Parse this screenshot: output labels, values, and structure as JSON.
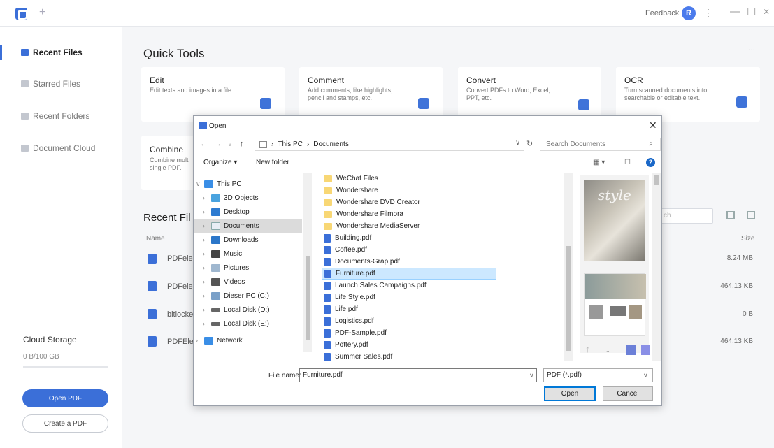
{
  "app": {
    "new_tab_label": "+",
    "feedback_label": "Feedback",
    "avatar_letter": "R",
    "kebab": "⋮",
    "minimize": "—",
    "maximize": "☐",
    "close": "✕"
  },
  "sidebar": {
    "items": [
      {
        "label": "Recent Files"
      },
      {
        "label": "Starred Files"
      },
      {
        "label": "Recent Folders"
      },
      {
        "label": "Document Cloud"
      }
    ],
    "cloud_title": "Cloud Storage",
    "cloud_size": "0 B/100 GB",
    "open_pdf": "Open PDF",
    "create_pdf": "Create a PDF"
  },
  "main": {
    "quick_tools_title": "Quick Tools",
    "more": "···",
    "cards": [
      {
        "title": "Edit",
        "desc": "Edit texts and images in a file."
      },
      {
        "title": "Comment",
        "desc": "Add comments, like highlights,\npencil and stamps, etc."
      },
      {
        "title": "Convert",
        "desc": "Convert PDFs to Word, Excel,\nPPT, etc."
      },
      {
        "title": "OCR",
        "desc": "Turn scanned documents into\nsearchable or editable text."
      },
      {
        "title": "Combine",
        "desc": "Combine mult\nsingle PDF."
      }
    ],
    "recent_title": "Recent Fil",
    "col_name": "Name",
    "col_size": "Size",
    "search_placeholder": "ch",
    "rows": [
      {
        "name": "PDFeler",
        "size": "8.24 MB"
      },
      {
        "name": "PDFeler",
        "size": "464.13 KB"
      },
      {
        "name": "bitlocke",
        "size": "0 B"
      },
      {
        "name": "PDFEler",
        "size": "464.13 KB"
      }
    ]
  },
  "dialog": {
    "title": "Open",
    "address": {
      "pc": "This PC",
      "folder": "Documents",
      "sep": "›"
    },
    "search_placeholder": "Search Documents",
    "organize": "Organize ▾",
    "new_folder": "New folder",
    "tree": [
      {
        "label": "This PC",
        "chev": "∨",
        "icon_color": "#3a8ee6"
      },
      {
        "label": "3D Objects",
        "chev": "›",
        "icon_color": "#4aa3df"
      },
      {
        "label": "Desktop",
        "chev": "›",
        "icon_color": "#2d7bd1"
      },
      {
        "label": "Documents",
        "chev": "›",
        "icon_color": "#e8eef5"
      },
      {
        "label": "Downloads",
        "chev": "›",
        "icon_color": "#2b76c9"
      },
      {
        "label": "Music",
        "chev": "›",
        "icon_color": "#444444"
      },
      {
        "label": "Pictures",
        "chev": "›",
        "icon_color": "#9fb7cf"
      },
      {
        "label": "Videos",
        "chev": "›",
        "icon_color": "#555555"
      },
      {
        "label": "Dieser PC (C:)",
        "chev": "›",
        "icon_color": "#7aa0c8"
      },
      {
        "label": "Local Disk (D:)",
        "chev": "›",
        "icon_color": "#666666"
      },
      {
        "label": "Local Disk (E:)",
        "chev": "›",
        "icon_color": "#666666"
      },
      {
        "label": "Network",
        "chev": "›",
        "icon_color": "#3a8ee6"
      }
    ],
    "files": [
      {
        "name": "WeChat Files",
        "type": "folder"
      },
      {
        "name": "Wondershare",
        "type": "folder"
      },
      {
        "name": "Wondershare DVD Creator",
        "type": "folder"
      },
      {
        "name": "Wondershare Filmora",
        "type": "folder"
      },
      {
        "name": "Wondershare MediaServer",
        "type": "folder"
      },
      {
        "name": "Building.pdf",
        "type": "pdf"
      },
      {
        "name": "Coffee.pdf",
        "type": "pdf"
      },
      {
        "name": "Documents-Grap.pdf",
        "type": "pdf"
      },
      {
        "name": "Furniture.pdf",
        "type": "pdf"
      },
      {
        "name": "Launch Sales Campaigns.pdf",
        "type": "pdf"
      },
      {
        "name": "Life Style.pdf",
        "type": "pdf"
      },
      {
        "name": "Life.pdf",
        "type": "pdf"
      },
      {
        "name": "Logistics.pdf",
        "type": "pdf"
      },
      {
        "name": "PDF-Sample.pdf",
        "type": "pdf"
      },
      {
        "name": "Pottery.pdf",
        "type": "pdf"
      },
      {
        "name": "Summer Sales.pdf",
        "type": "pdf"
      }
    ],
    "preview_text": "style",
    "file_name_label": "File name:",
    "file_name_value": "Furniture.pdf",
    "file_type": "PDF (*.pdf)",
    "open_button": "Open",
    "cancel_button": "Cancel"
  }
}
